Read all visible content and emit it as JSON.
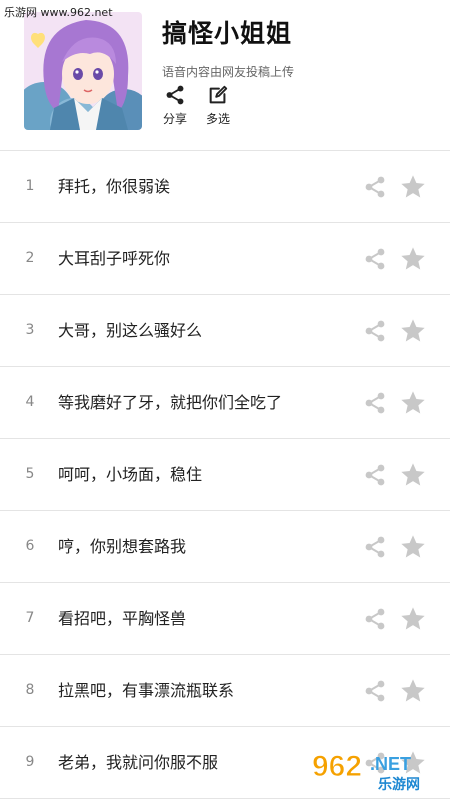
{
  "watermark": {
    "site_text": "乐游网 www.962.net",
    "logo_number": "962",
    "logo_net": ".NET",
    "logo_cn": "乐游网"
  },
  "header": {
    "title": "搞怪小姐姐",
    "subtitle": "语音内容由网友投稿上传",
    "share_label": "分享",
    "multi_select_label": "多选"
  },
  "items": [
    {
      "index": "1",
      "text": "拜托，你很弱诶"
    },
    {
      "index": "2",
      "text": "大耳刮子呼死你"
    },
    {
      "index": "3",
      "text": "大哥，别这么骚好么"
    },
    {
      "index": "4",
      "text": "等我磨好了牙，就把你们全吃了"
    },
    {
      "index": "5",
      "text": "呵呵，小场面，稳住"
    },
    {
      "index": "6",
      "text": "哼，你别想套路我"
    },
    {
      "index": "7",
      "text": "看招吧，平胸怪兽"
    },
    {
      "index": "8",
      "text": "拉黑吧，有事漂流瓶联系"
    },
    {
      "index": "9",
      "text": "老弟，我就问你服不服"
    }
  ],
  "icons": {
    "share": "share-icon",
    "edit": "edit-icon",
    "star": "star-icon"
  },
  "colors": {
    "icon_gray": "#c8c8c8",
    "divider": "#e4e4e4",
    "title": "#111111"
  }
}
